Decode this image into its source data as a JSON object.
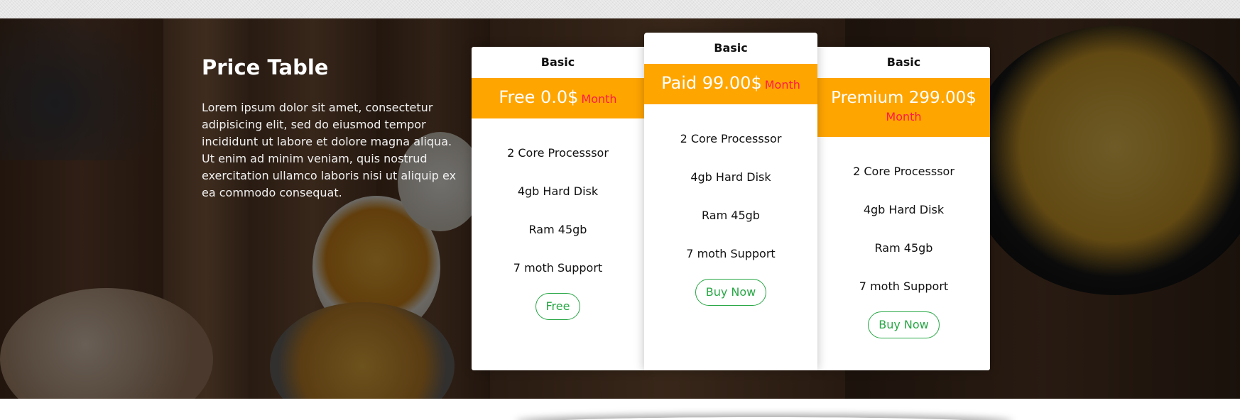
{
  "section": {
    "title": "Price Table",
    "description": "Lorem ipsum dolor sit amet, consectetur adipisicing elit, sed do eiusmod tempor incididunt ut labore et dolore magna aliqua. Ut enim ad minim veniam, quis nostrud exercitation ullamco laboris nisi ut aliquip ex ea commodo consequat."
  },
  "plans": [
    {
      "name": "Basic",
      "price": "Free 0.0$",
      "unit": "Month",
      "features": [
        "2 Core Processsor",
        "4gb Hard Disk",
        "Ram 45gb",
        "7 moth Support"
      ],
      "button": "Free"
    },
    {
      "name": "Basic",
      "price": "Paid 99.00$",
      "unit": "Month",
      "features": [
        "2 Core Processsor",
        "4gb Hard Disk",
        "Ram 45gb",
        "7 moth Support"
      ],
      "button": "Buy Now"
    },
    {
      "name": "Basic",
      "price": "Premium 299.00$",
      "unit": "Month",
      "features": [
        "2 Core Processsor",
        "4gb Hard Disk",
        "Ram 45gb",
        "7 moth Support"
      ],
      "button": "Buy Now"
    }
  ],
  "colors": {
    "price_band": "#ffa500",
    "unit_text": "#ff1a4a",
    "button": "#28a745",
    "overlay": "#000000"
  }
}
